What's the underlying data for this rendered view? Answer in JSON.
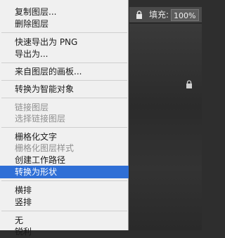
{
  "layers_panel": {
    "fill_label": "填充:",
    "fill_value": "100%"
  },
  "menu": {
    "items": [
      {
        "label": "复制图层...",
        "enabled": true
      },
      {
        "label": "删除图层",
        "enabled": true
      },
      {
        "label": "快速导出为 PNG",
        "enabled": true
      },
      {
        "label": "导出为...",
        "enabled": true
      },
      {
        "label": "来自图层的画板...",
        "enabled": true
      },
      {
        "label": "转换为智能对象",
        "enabled": true
      },
      {
        "label": "链接图层",
        "enabled": false
      },
      {
        "label": "选择链接图层",
        "enabled": false
      },
      {
        "label": "栅格化文字",
        "enabled": true
      },
      {
        "label": "栅格化图层样式",
        "enabled": false
      },
      {
        "label": "创建工作路径",
        "enabled": true
      },
      {
        "label": "转换为形状",
        "enabled": true,
        "highlighted": true
      },
      {
        "label": "横排",
        "enabled": true
      },
      {
        "label": "竖排",
        "enabled": true
      },
      {
        "label": "无",
        "enabled": true
      },
      {
        "label": "锐利",
        "enabled": true
      }
    ]
  },
  "colors": {
    "menu_bg": "#f0f0f0",
    "highlight": "#2f6fd6",
    "disabled_text": "#8f8f8f",
    "panel_bg": "#2e2e2e"
  }
}
